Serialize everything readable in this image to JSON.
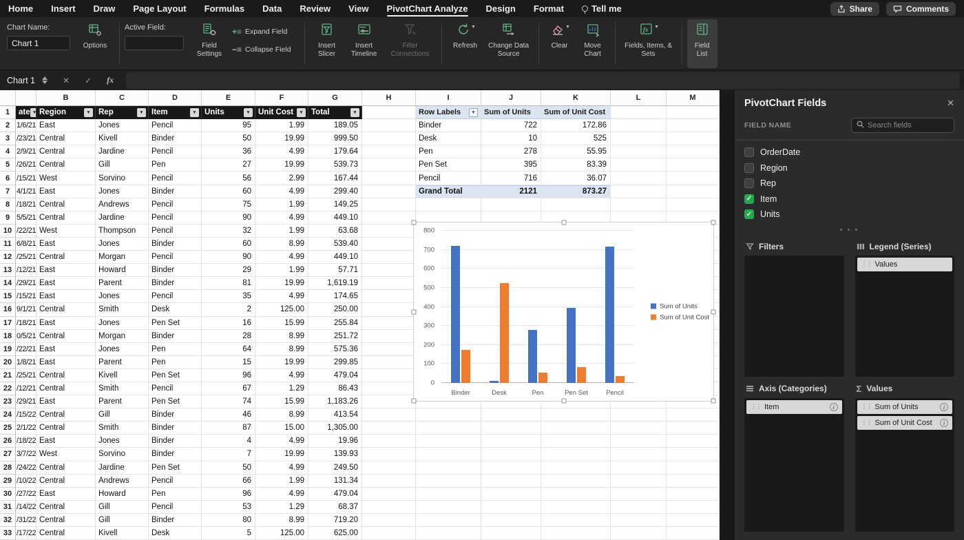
{
  "colors": {
    "checkbox_green": "#23a94e"
  },
  "menu_bar": {
    "items": [
      "Home",
      "Insert",
      "Draw",
      "Page Layout",
      "Formulas",
      "Data",
      "Review",
      "View",
      "PivotChart Analyze",
      "Design",
      "Format",
      "Tell me"
    ],
    "active_item": "PivotChart Analyze",
    "share_label": "Share",
    "comments_label": "Comments"
  },
  "ribbon": {
    "chart_name_label": "Chart Name:",
    "chart_name_value": "Chart 1",
    "options_label": "Options",
    "active_field_label": "Active Field:",
    "field_settings_label": "Field Settings",
    "expand_field_label": "Expand Field",
    "collapse_field_label": "Collapse Field",
    "insert_slicer_label": "Insert Slicer",
    "insert_timeline_label": "Insert Timeline",
    "filter_connections_label": "Filter Connections",
    "refresh_label": "Refresh",
    "change_data_source_label": "Change Data Source",
    "clear_label": "Clear",
    "move_chart_label": "Move Chart",
    "fields_items_sets_label": "Fields, Items, & Sets",
    "field_list_label": "Field List"
  },
  "formula_bar": {
    "name_box": "Chart 1",
    "fx_label": "fx"
  },
  "grid": {
    "column_letters": [
      "",
      "B",
      "C",
      "D",
      "E",
      "F",
      "G",
      "H",
      "I",
      "J",
      "K",
      "L",
      "M"
    ]
  },
  "data_table": {
    "headers": [
      "ate",
      "Region",
      "Rep",
      "Item",
      "Units",
      "Unit Cost",
      "Total"
    ],
    "rows": [
      [
        "1/6/21",
        "East",
        "Jones",
        "Pencil",
        "95",
        "1.99",
        "189.05"
      ],
      [
        "/23/21",
        "Central",
        "Kivell",
        "Binder",
        "50",
        "19.99",
        "999.50"
      ],
      [
        "2/9/21",
        "Central",
        "Jardine",
        "Pencil",
        "36",
        "4.99",
        "179.64"
      ],
      [
        "/26/21",
        "Central",
        "Gill",
        "Pen",
        "27",
        "19.99",
        "539.73"
      ],
      [
        "/15/21",
        "West",
        "Sorvino",
        "Pencil",
        "56",
        "2.99",
        "167.44"
      ],
      [
        "4/1/21",
        "East",
        "Jones",
        "Binder",
        "60",
        "4.99",
        "299.40"
      ],
      [
        "/18/21",
        "Central",
        "Andrews",
        "Pencil",
        "75",
        "1.99",
        "149.25"
      ],
      [
        "5/5/21",
        "Central",
        "Jardine",
        "Pencil",
        "90",
        "4.99",
        "449.10"
      ],
      [
        "/22/21",
        "West",
        "Thompson",
        "Pencil",
        "32",
        "1.99",
        "63.68"
      ],
      [
        "6/8/21",
        "East",
        "Jones",
        "Binder",
        "60",
        "8.99",
        "539.40"
      ],
      [
        "/25/21",
        "Central",
        "Morgan",
        "Pencil",
        "90",
        "4.99",
        "449.10"
      ],
      [
        "/12/21",
        "East",
        "Howard",
        "Binder",
        "29",
        "1.99",
        "57.71"
      ],
      [
        "/29/21",
        "East",
        "Parent",
        "Binder",
        "81",
        "19.99",
        "1,619.19"
      ],
      [
        "/15/21",
        "East",
        "Jones",
        "Pencil",
        "35",
        "4.99",
        "174.65"
      ],
      [
        "9/1/21",
        "Central",
        "Smith",
        "Desk",
        "2",
        "125.00",
        "250.00"
      ],
      [
        "/18/21",
        "East",
        "Jones",
        "Pen Set",
        "16",
        "15.99",
        "255.84"
      ],
      [
        "0/5/21",
        "Central",
        "Morgan",
        "Binder",
        "28",
        "8.99",
        "251.72"
      ],
      [
        "/22/21",
        "East",
        "Jones",
        "Pen",
        "64",
        "8.99",
        "575.36"
      ],
      [
        "1/8/21",
        "East",
        "Parent",
        "Pen",
        "15",
        "19.99",
        "299.85"
      ],
      [
        "/25/21",
        "Central",
        "Kivell",
        "Pen Set",
        "96",
        "4.99",
        "479.04"
      ],
      [
        "/12/21",
        "Central",
        "Smith",
        "Pencil",
        "67",
        "1.29",
        "86.43"
      ],
      [
        "/29/21",
        "East",
        "Parent",
        "Pen Set",
        "74",
        "15.99",
        "1,183.26"
      ],
      [
        "/15/22",
        "Central",
        "Gill",
        "Binder",
        "46",
        "8.99",
        "413.54"
      ],
      [
        "2/1/22",
        "Central",
        "Smith",
        "Binder",
        "87",
        "15.00",
        "1,305.00"
      ],
      [
        "/18/22",
        "East",
        "Jones",
        "Binder",
        "4",
        "4.99",
        "19.96"
      ],
      [
        "3/7/22",
        "West",
        "Sorvino",
        "Binder",
        "7",
        "19.99",
        "139.93"
      ],
      [
        "/24/22",
        "Central",
        "Jardine",
        "Pen Set",
        "50",
        "4.99",
        "249.50"
      ],
      [
        "/10/22",
        "Central",
        "Andrews",
        "Pencil",
        "66",
        "1.99",
        "131.34"
      ],
      [
        "/27/22",
        "East",
        "Howard",
        "Pen",
        "96",
        "4.99",
        "479.04"
      ],
      [
        "/14/22",
        "Central",
        "Gill",
        "Pencil",
        "53",
        "1.29",
        "68.37"
      ],
      [
        "/31/22",
        "Central",
        "Gill",
        "Binder",
        "80",
        "8.99",
        "719.20"
      ],
      [
        "/17/22",
        "Central",
        "Kivell",
        "Desk",
        "5",
        "125.00",
        "625.00"
      ]
    ]
  },
  "pivot_table": {
    "headers": [
      "Row Labels",
      "Sum of Units",
      "Sum of Unit Cost"
    ],
    "rows": [
      [
        "Binder",
        "722",
        "172.86"
      ],
      [
        "Desk",
        "10",
        "525"
      ],
      [
        "Pen",
        "278",
        "55.95"
      ],
      [
        "Pen Set",
        "395",
        "83.39"
      ],
      [
        "Pencil",
        "716",
        "36.07"
      ]
    ],
    "grand_total": [
      "Grand Total",
      "2121",
      "873.27"
    ]
  },
  "chart_data": {
    "type": "bar",
    "title": "",
    "categories": [
      "Binder",
      "Desk",
      "Pen",
      "Pen Set",
      "Pencil"
    ],
    "series": [
      {
        "name": "Sum of Units",
        "color": "#4472c4",
        "values": [
          722,
          10,
          278,
          395,
          716
        ]
      },
      {
        "name": "Sum of Unit Cost",
        "color": "#ed7d31",
        "values": [
          172.86,
          525,
          55.95,
          83.39,
          36.07
        ]
      }
    ],
    "ylim": [
      0,
      800
    ],
    "yticks": [
      0,
      100,
      200,
      300,
      400,
      500,
      600,
      700,
      800
    ],
    "legend_position": "right",
    "grid": true
  },
  "fields_panel": {
    "title": "PivotChart Fields",
    "field_name_label": "FIELD NAME",
    "search_placeholder": "Search fields",
    "fields": [
      {
        "name": "OrderDate",
        "checked": false
      },
      {
        "name": "Region",
        "checked": false
      },
      {
        "name": "Rep",
        "checked": false
      },
      {
        "name": "Item",
        "checked": true
      },
      {
        "name": "Units",
        "checked": true
      }
    ],
    "areas": {
      "filters_label": "Filters",
      "legend_label": "Legend (Series)",
      "axis_label": "Axis (Categories)",
      "values_label": "Values",
      "legend_items": [
        {
          "label": "Values",
          "info": false
        }
      ],
      "axis_items": [
        {
          "label": "Item",
          "info": true
        }
      ],
      "values_items": [
        {
          "label": "Sum of Units",
          "info": true
        },
        {
          "label": "Sum of Unit Cost",
          "info": true
        }
      ]
    }
  }
}
